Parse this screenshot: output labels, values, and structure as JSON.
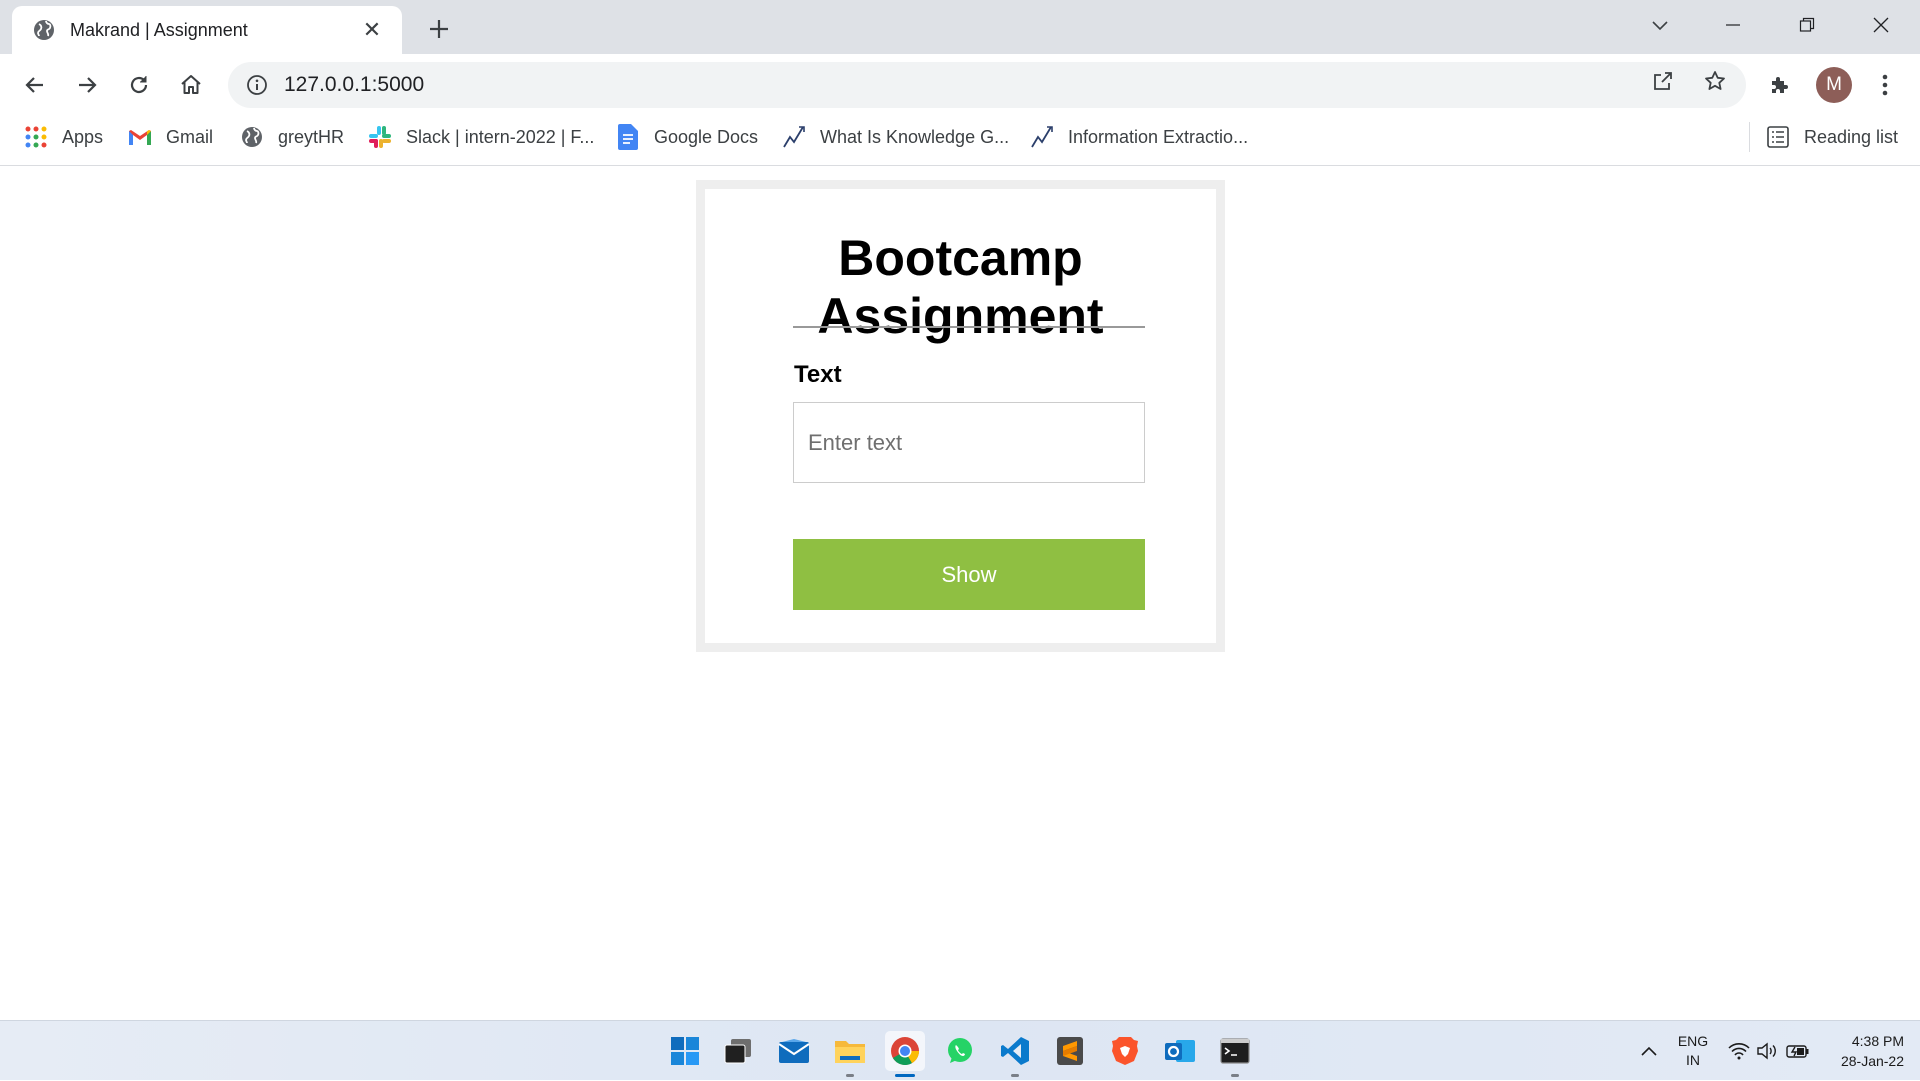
{
  "browser": {
    "tab_title": "Makrand | Assignment",
    "tab_close": "✕",
    "url": "127.0.0.1:5000",
    "profile_initial": "M"
  },
  "bookmarks": [
    {
      "label": "Apps",
      "icon": "apps-grid-icon"
    },
    {
      "label": "Gmail",
      "icon": "gmail-icon"
    },
    {
      "label": "greytHR",
      "icon": "globe-icon"
    },
    {
      "label": "Slack | intern-2022 | F...",
      "icon": "slack-icon"
    },
    {
      "label": "Google Docs",
      "icon": "google-docs-icon"
    },
    {
      "label": "What Is Knowledge G...",
      "icon": "trend-icon"
    },
    {
      "label": "Information Extractio...",
      "icon": "trend-icon"
    }
  ],
  "reading_list": "Reading list",
  "page": {
    "heading": "Bootcamp Assignment",
    "field_label": "Text",
    "input_placeholder": "Enter text",
    "input_value": "",
    "button_label": "Show",
    "accent_color": "#8fbf42"
  },
  "taskbar": {
    "apps": [
      "windows-start",
      "task-view",
      "mail",
      "file-explorer",
      "chrome",
      "whatsapp",
      "vscode",
      "sublime-text",
      "brave",
      "outlook",
      "terminal"
    ],
    "language": {
      "line1": "ENG",
      "line2": "IN"
    },
    "time": "4:38 PM",
    "date": "28-Jan-22"
  }
}
